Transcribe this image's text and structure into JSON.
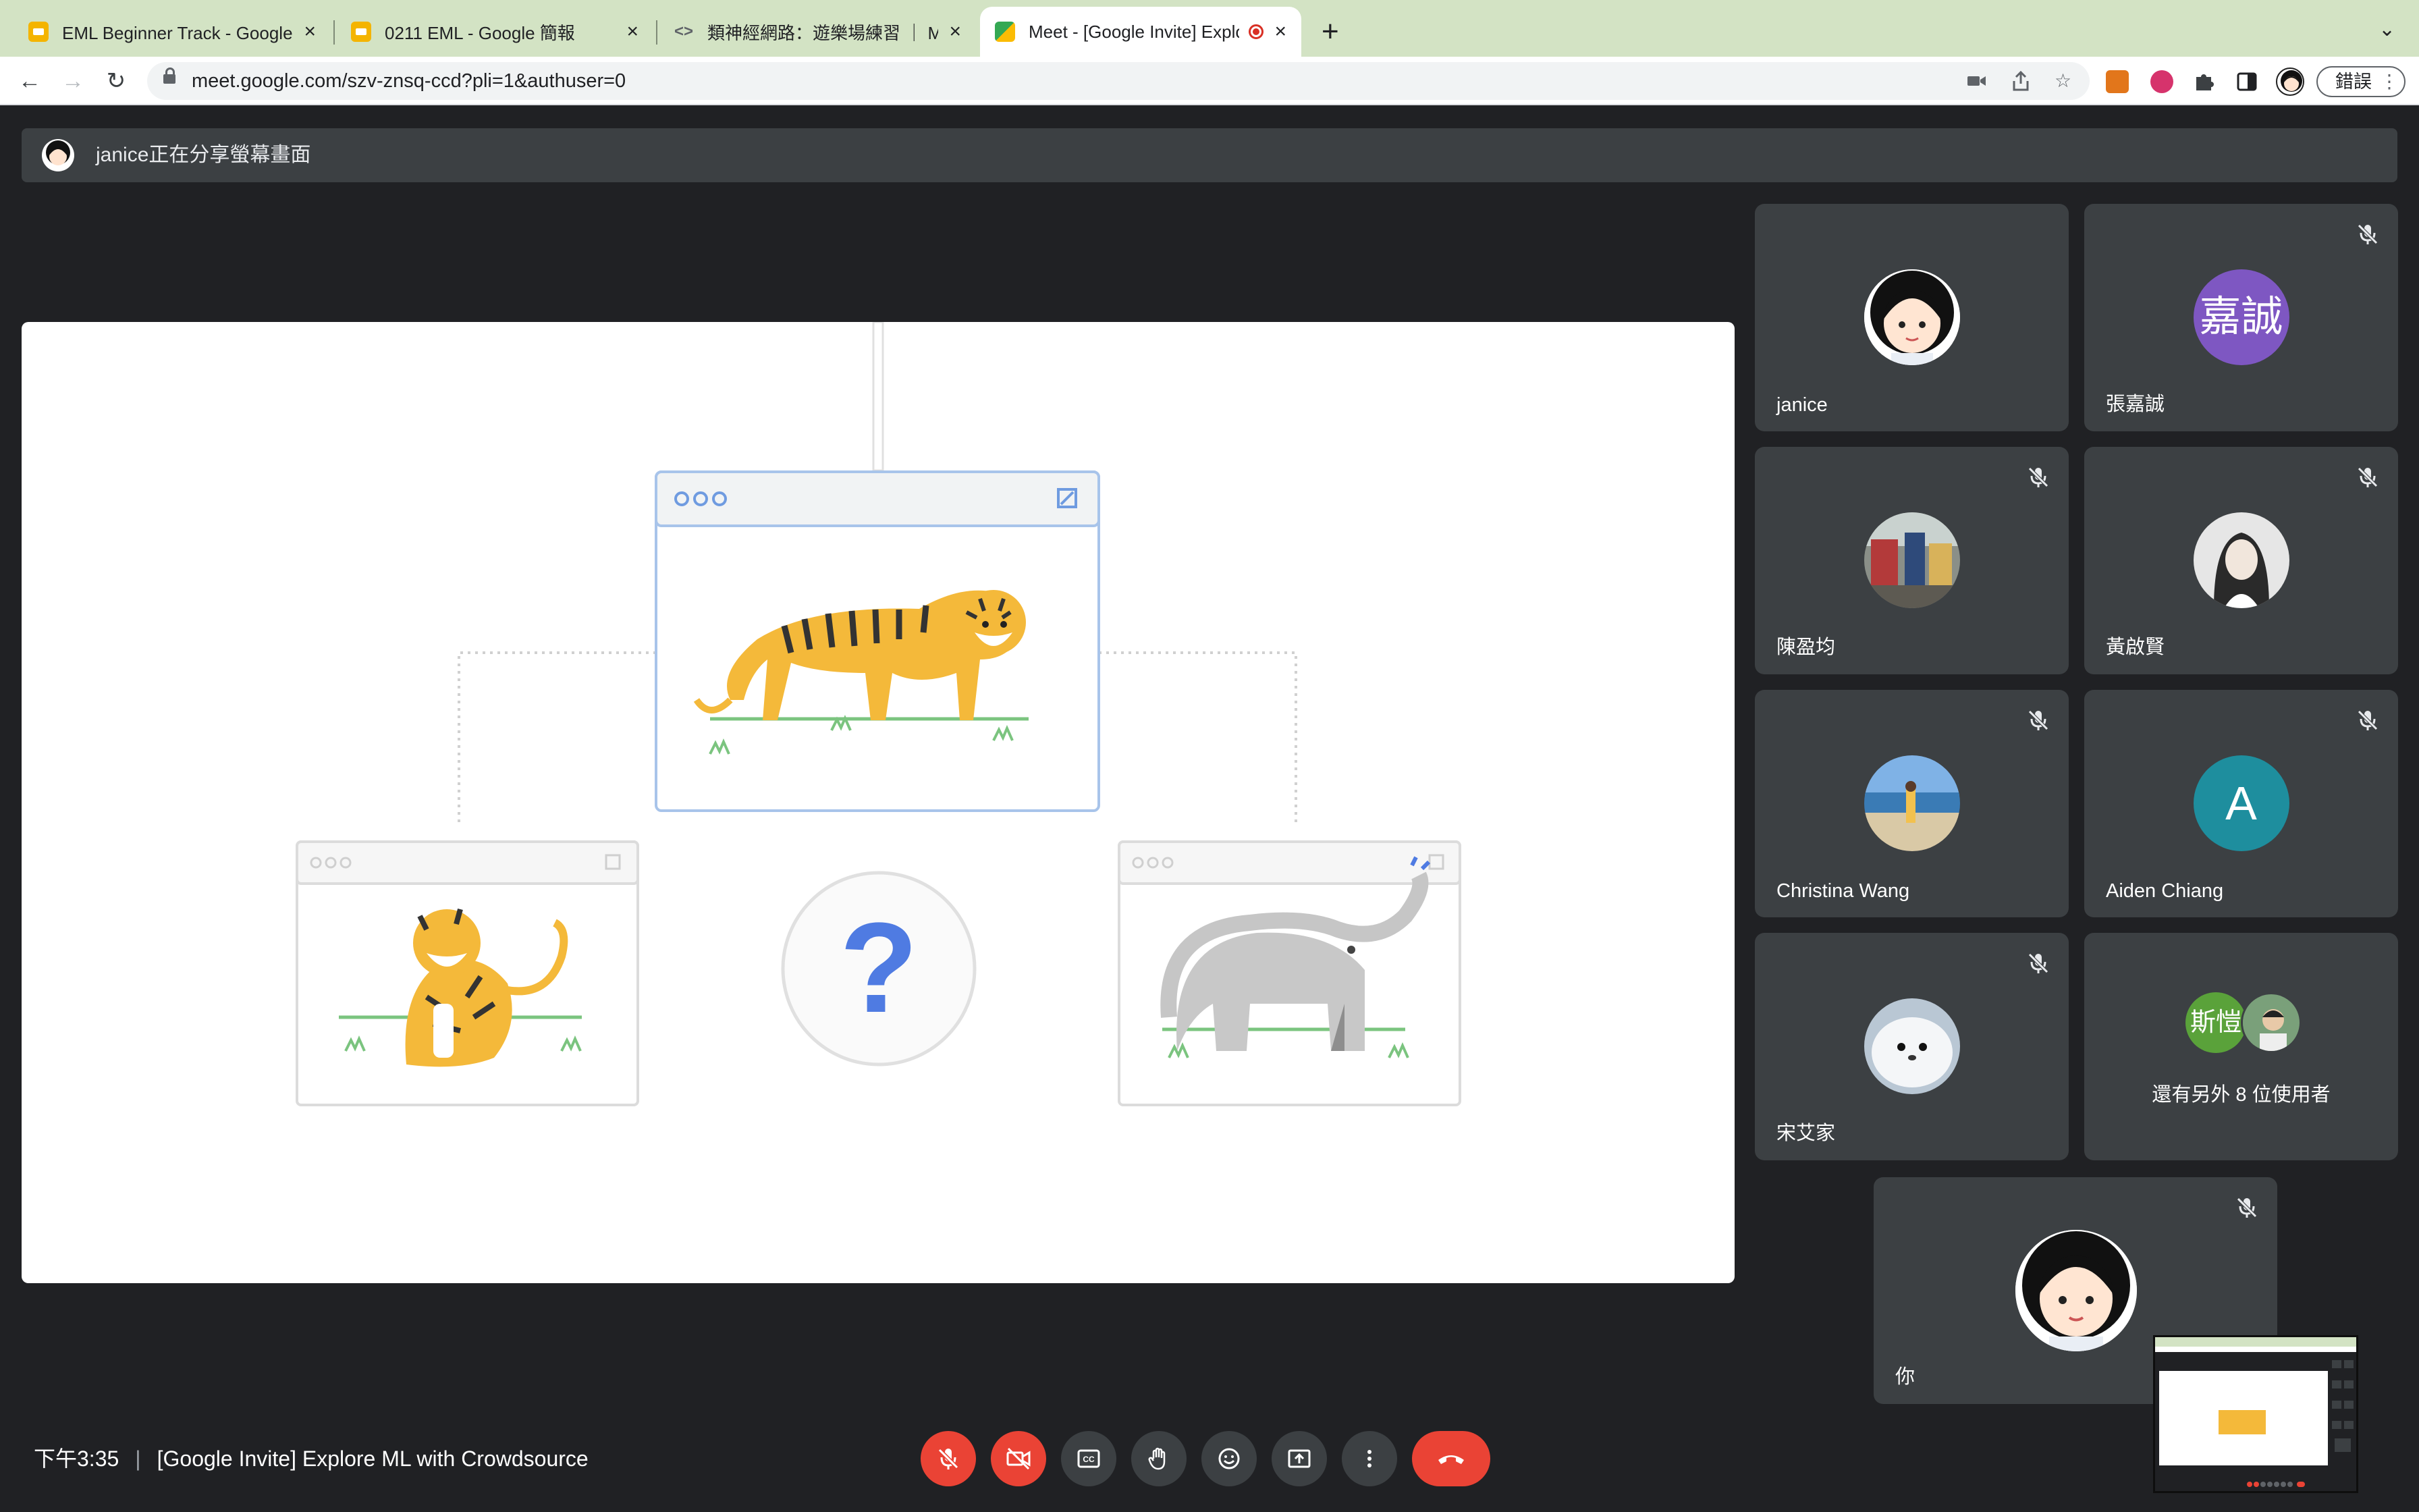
{
  "browser": {
    "tabs": [
      {
        "title": "EML Beginner Track - Google 簡報"
      },
      {
        "title": "0211 EML - Google 簡報"
      },
      {
        "title": "類神經網路：遊樂場練習 ｜ Machine Learning"
      },
      {
        "title": "Meet - [Google Invite] Explore ML with Crowdsource"
      }
    ],
    "url": "meet.google.com/szv-znsq-ccd?pli=1&authuser=0",
    "profile_button": "錯誤"
  },
  "meet": {
    "presenter_banner": "janice正在分享螢幕畫面",
    "participants": [
      {
        "name": "janice",
        "muted": false,
        "avatar": "cartoon-girl-photo"
      },
      {
        "name": "張嘉誠",
        "muted": true,
        "initials": "嘉誠",
        "color": "#7e57c2"
      },
      {
        "name": "陳盈均",
        "muted": true,
        "avatar": "group-photo"
      },
      {
        "name": "黃啟賢",
        "muted": true,
        "avatar": "portrait-photo"
      },
      {
        "name": "Christina Wang",
        "muted": true,
        "avatar": "beach-photo"
      },
      {
        "name": "Aiden Chiang",
        "muted": true,
        "initials": "A",
        "color": "#1e8e9e"
      },
      {
        "name": "宋艾家",
        "muted": true,
        "avatar": "seal-photo"
      }
    ],
    "others": {
      "initials": "斯愷",
      "color": "#5aa23a",
      "text": "還有另外 8 位使用者"
    },
    "self": {
      "name": "你",
      "muted": true
    },
    "time": "下午3:35",
    "meeting_title": "[Google Invite] Explore ML with Crowdsource",
    "colors": {
      "background": "#202124",
      "tile": "#3c4043",
      "danger": "#ea4335"
    }
  },
  "slide": {
    "question_mark": "?"
  }
}
